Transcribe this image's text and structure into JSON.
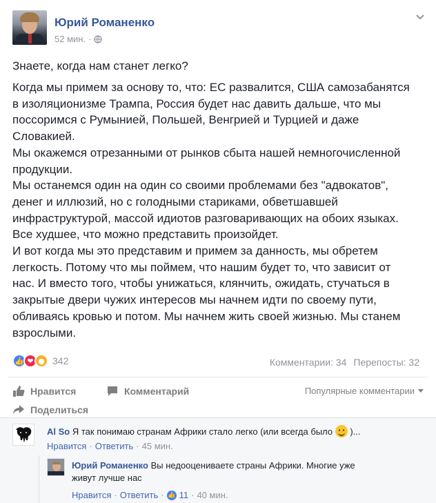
{
  "post": {
    "author": "Юрий Романенко",
    "time": "52 мин.",
    "meta_sep": "·",
    "lead": "Знаете, когда нам станет легко?",
    "body_lines": [
      "Когда мы примем за основу то, что: ЕС развалится, США самозабанятся",
      "в изоляционизме Трампа, Россия будет нас давить дальше, что мы",
      "поссоримся с Румынией, Польшей, Венгрией и Турцией и даже",
      "Словакией.",
      "Мы окажемся отрезанными от рынков сбыта нашей немногочисленной",
      "продукции.",
      "Мы останемся один на один со своими проблемами без \"адвокатов\",",
      "денег и иллюзий, но с голодными стариками, обветшавшей",
      "инфраструктурой, массой идиотов разговаривающих на обоих языках.",
      "Все худшее, что можно представить произойдет.",
      "И вот когда мы это представим и примем за данность, мы обретем",
      "легкость. Потому что мы поймем, что нашим будет то, что зависит от",
      "нас. И вместо того, чтобы унижаться, клянчить, ожидать, стучаться в",
      "закрытые двери чужих интересов мы начнем идти по своему пути,",
      "обливаясь кровью и потом. Мы начнем жить своей жизнью. Мы станем",
      "взрослыми."
    ],
    "reactions_count": "342",
    "comments_stat": "Комментарии: 34",
    "shares_stat": "Перепосты: 32"
  },
  "actions": {
    "like": "Нравится",
    "comment": "Комментарий",
    "share": "Поделиться",
    "popular": "Популярные комментарии"
  },
  "comments": [
    {
      "author": "Al So",
      "text": "Я так понимаю странам Африки стало легко (или всегда было",
      "text_tail": ")...",
      "like": "Нравится",
      "sep": "·",
      "reply": "Ответить",
      "time": "45 мин."
    },
    {
      "author": "Юрий Романенко",
      "text_line1": "Вы недооцениваете страны Африки. Многие уже",
      "text_line2": "живут лучше нас",
      "like": "Нравится",
      "sep": "·",
      "reply": "Ответить",
      "like_count": "11",
      "time": "40 мин."
    }
  ],
  "colors": {
    "link": "#365899",
    "muted": "#90949c",
    "like_blue": "#4080ff",
    "love_red": "#f0284a",
    "sad_yellow": "#f7b125"
  }
}
